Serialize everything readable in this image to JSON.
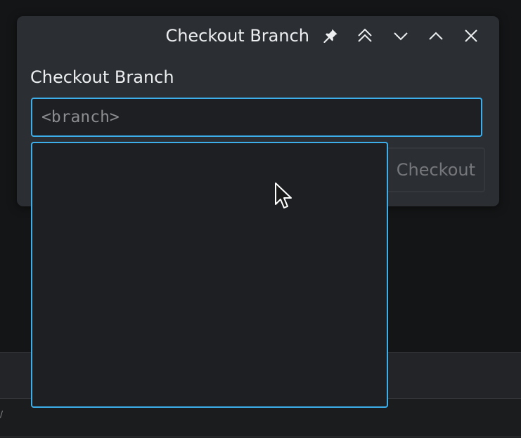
{
  "window": {
    "title": "Checkout Branch"
  },
  "titlebar_buttons": [
    {
      "icon": "pin-icon"
    },
    {
      "icon": "keep-above-icon"
    },
    {
      "icon": "minimize-icon"
    },
    {
      "icon": "maximize-icon"
    },
    {
      "icon": "close-icon"
    }
  ],
  "form": {
    "label": "Checkout Branch",
    "branch_input": {
      "value": "",
      "placeholder": "<branch>"
    },
    "checkout_button_label": "Checkout"
  },
  "dropdown": {
    "items": []
  },
  "colors": {
    "accent": "#3daee9",
    "dialog_bg": "#2b2e33",
    "field_bg": "#1d1f22",
    "text": "#eceef0",
    "disabled_text": "#75777b"
  }
}
